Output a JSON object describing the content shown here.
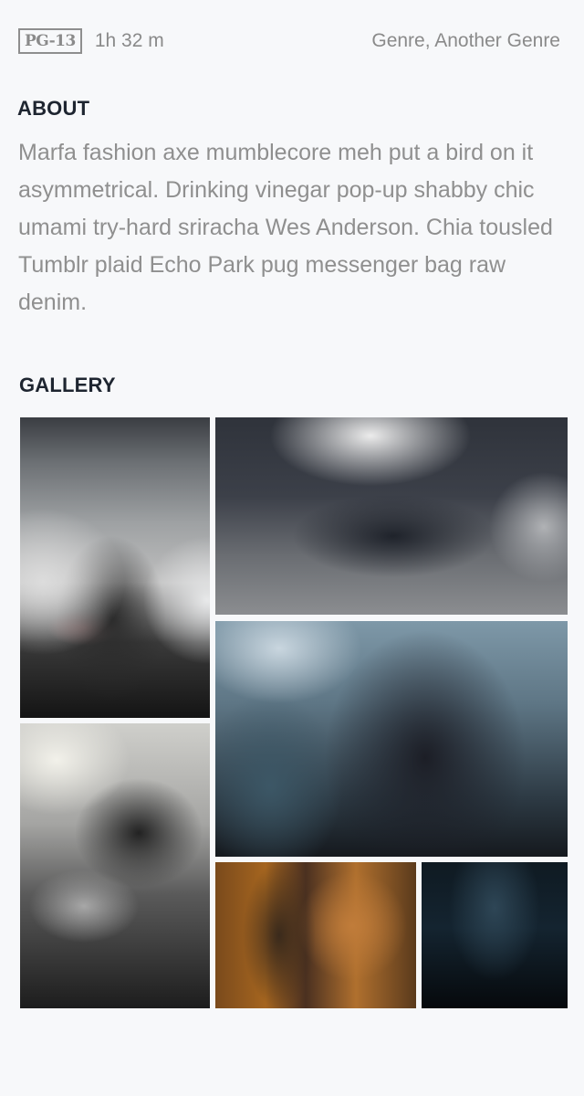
{
  "meta": {
    "rating": "PG-13",
    "runtime": "1h 32 m",
    "genres": "Genre, Another Genre"
  },
  "about": {
    "title": "ABOUT",
    "text": "Marfa fashion axe mumblecore meh put a bird on it asymmetrical. Drinking vinegar pop-up shabby chic umami try-hard sriracha Wes Anderson. Chia tousled Tumblr plaid Echo Park pug messenger bag raw denim."
  },
  "gallery": {
    "title": "GALLERY",
    "image_count": 6
  }
}
